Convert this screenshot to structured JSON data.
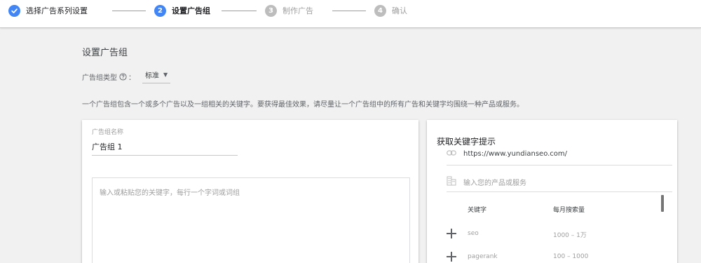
{
  "stepper": {
    "steps": [
      {
        "number": "",
        "label": "选择广告系列设置",
        "state": "done"
      },
      {
        "number": "2",
        "label": "设置广告组",
        "state": "active"
      },
      {
        "number": "3",
        "label": "制作广告",
        "state": "pending"
      },
      {
        "number": "4",
        "label": "确认",
        "state": "pending"
      }
    ]
  },
  "main": {
    "title": "设置广告组",
    "ad_group_type": {
      "label": "广告组类型",
      "colon": "：",
      "value": "标准"
    },
    "description": "一个广告组包含一个或多个广告以及一组相关的关键字。要获得最佳效果，请尽量让一个广告组中的所有广告和关键字均围绕一种产品或服务。"
  },
  "ad_group_form": {
    "name_label": "广告组名称",
    "name_value": "广告组 1",
    "keywords_placeholder": "输入或粘贴您的关键字，每行一个字词或词组"
  },
  "keyword_ideas": {
    "title": "获取关键字提示",
    "url": "https://www.yundianseo.com/",
    "product_placeholder": "输入您的产品或服务",
    "columns": [
      "关键字",
      "每月搜索量"
    ],
    "rows": [
      {
        "keyword": "seo",
        "volume": "1000 – 1万"
      },
      {
        "keyword": "pagerank",
        "volume": "100 – 1000"
      }
    ]
  },
  "colors": {
    "accent": "#4285f4",
    "pending": "#bdbdbd",
    "background": "#f1f1f1"
  }
}
